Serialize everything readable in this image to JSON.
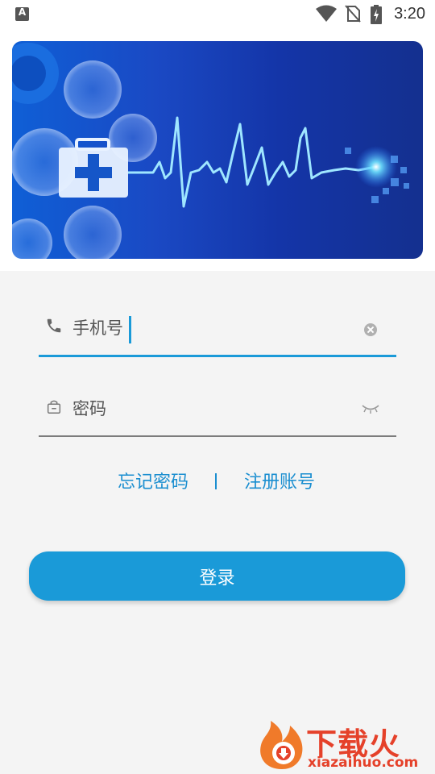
{
  "status_bar": {
    "time": "3:20",
    "icons": [
      "text-input-icon",
      "wifi-icon",
      "no-sim-icon",
      "battery-charging-icon"
    ]
  },
  "banner": {
    "slides": 2,
    "active_slide": 1,
    "image": "medical-ecg-heartbeat-banner"
  },
  "form": {
    "phone": {
      "placeholder": "手机号",
      "value": "",
      "icon": "phone-icon",
      "clear_icon": "clear-icon"
    },
    "password": {
      "placeholder": "密码",
      "value": "",
      "icon": "lock-icon",
      "toggle_icon": "eye-closed-icon"
    }
  },
  "links": {
    "forgot_password": "忘记密码",
    "separator": "|",
    "register": "注册账号"
  },
  "login_button": "登录",
  "watermark": {
    "title": "下载火",
    "url": "xiazaihuo.com"
  },
  "colors": {
    "accent": "#1a9ad8",
    "background": "#f4f4f4",
    "watermark": "#e5412a"
  }
}
